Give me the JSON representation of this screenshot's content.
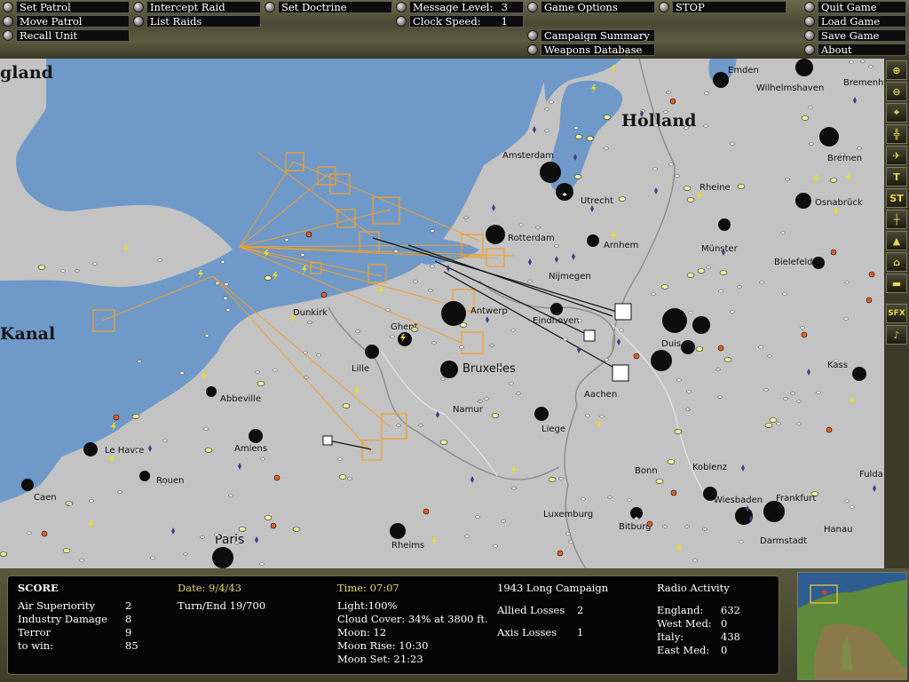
{
  "toolbar": {
    "set_patrol": "Set Patrol",
    "move_patrol": "Move Patrol",
    "recall_unit": "Recall Unit",
    "intercept_raid": "Intercept Raid",
    "list_raids": "List Raids",
    "set_doctrine": "Set Doctrine",
    "message_level_label": "Message Level:",
    "message_level_value": "3",
    "clock_speed_label": "Clock Speed:",
    "clock_speed_value": "1",
    "game_options": "Game Options",
    "campaign_summary": "Campaign Summary",
    "weapons_database": "Weapons Database",
    "stop": "STOP",
    "quit_game": "Quit Game",
    "load_game": "Load Game",
    "save_game": "Save Game",
    "about": "About"
  },
  "map": {
    "regions": {
      "england": "gland",
      "holland": "Holland",
      "kanal": "Kanal"
    },
    "places": {
      "emden": "Emden",
      "wilhelmshaven": "Wilhelmshaven",
      "bremen": "Bremenha",
      "bremenb": "Bremen",
      "amsterdam": "Amsterdam",
      "utrecht": "Utrecht",
      "rheine": "Rheine",
      "osnabruck": "Osnabrück",
      "rotterdam": "Rotterdam",
      "arnhem": "Arnhem",
      "munster": "Münster",
      "bielefeld": "Bielefeld",
      "nijmegen": "Nijmegen",
      "antwerp": "Antwerp",
      "eindhoven": "Eindhoven",
      "dunkirk": "Dunkirk",
      "ghent": "Ghent",
      "lille": "Lille",
      "bruxelles": "Bruxelles",
      "duisburg": "Duis",
      "kassel": "Kass",
      "abbeville": "Abbeville",
      "namur": "Namur",
      "aachen": "Aachen",
      "liege": "Liege",
      "le_havre": "Le Havre",
      "amiens": "Amiens",
      "rouen": "Rouen",
      "bonn": "Bonn",
      "koblenz": "Koblenz",
      "fulda": "Fulda",
      "caen": "Caen",
      "wiesbaden": "Wiesbaden",
      "frankfurt": "Frankfurt",
      "luxemburg": "Luxemburg",
      "paris": "Paris",
      "bitburg": "Bitburg",
      "darmstadt": "Darmstadt",
      "hanau": "Hanau",
      "rheims": "Rheims"
    }
  },
  "tools": [
    "zoom-in",
    "zoom-out",
    "center",
    "grid",
    "plane",
    "target",
    "ST",
    "scale",
    "terrain",
    "city",
    "ground",
    "SFX",
    "music"
  ],
  "score": {
    "title": "SCORE",
    "air_superiority_label": "Air Superiority",
    "air_superiority": "2",
    "industry_damage_label": "Industry Damage",
    "industry_damage": "8",
    "terror_label": "Terror",
    "terror": "9",
    "to_win_label": "to win:",
    "to_win": "85",
    "date_label": "Date: 9/4/43",
    "turn_label": "Turn/End 19/700",
    "time_label": "Time: 07:07",
    "light": "Light:100%",
    "cloud": "Cloud Cover: 34% at 3800 ft.",
    "moon": "Moon: 12",
    "moon_rise": "Moon Rise: 10:30",
    "moon_set": "Moon Set: 21:23",
    "campaign": "1943 Long Campaign",
    "allied_losses_label": "Allied Losses",
    "allied_losses": "2",
    "axis_losses_label": "Axis Losses",
    "axis_losses": "1",
    "radio_title": "Radio Activity",
    "england_label": "England:",
    "england": "632",
    "westmed_label": "West Med:",
    "westmed": "0",
    "italy_label": "Italy:",
    "italy": "438",
    "eastmed_label": "East Med:",
    "eastmed": "0"
  },
  "colors": {
    "sea": "#6f99c8",
    "land": "#c3c3c3",
    "route": "#f0a030"
  }
}
